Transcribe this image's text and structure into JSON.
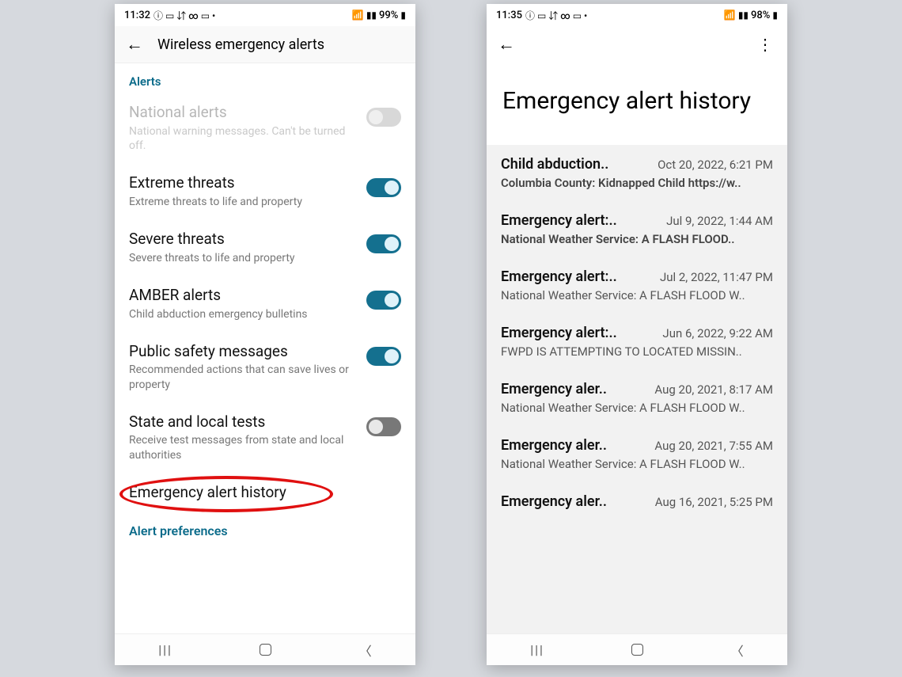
{
  "left": {
    "status": {
      "time": "11:32",
      "battery": "99%"
    },
    "title": "Wireless emergency alerts",
    "section": "Alerts",
    "items": [
      {
        "title": "National alerts",
        "sub": "National warning messages. Can't be turned off.",
        "state": "disabled"
      },
      {
        "title": "Extreme threats",
        "sub": "Extreme threats to life and property",
        "state": "on"
      },
      {
        "title": "Severe threats",
        "sub": "Severe threats to life and property",
        "state": "on"
      },
      {
        "title": "AMBER alerts",
        "sub": "Child abduction emergency bulletins",
        "state": "on"
      },
      {
        "title": "Public safety messages",
        "sub": "Recommended actions that can save lives or property",
        "state": "on"
      },
      {
        "title": "State and local tests",
        "sub": "Receive test messages from state and local authorities",
        "state": "off"
      }
    ],
    "history_link": "Emergency alert history",
    "pref_link": "Alert preferences"
  },
  "right": {
    "status": {
      "time": "11:35",
      "battery": "98%"
    },
    "title": "Emergency alert history",
    "items": [
      {
        "title": "Child abduction..",
        "date": "Oct 20, 2022, 6:21 PM",
        "body": "Columbia County: Kidnapped Child https://w..",
        "bold": true
      },
      {
        "title": "Emergency alert:..",
        "date": "Jul 9, 2022, 1:44 AM",
        "body": "National Weather Service: A FLASH FLOOD..",
        "bold": true
      },
      {
        "title": "Emergency alert:..",
        "date": "Jul 2, 2022, 11:47 PM",
        "body": "National Weather Service: A FLASH FLOOD W..",
        "bold": false
      },
      {
        "title": "Emergency alert:..",
        "date": "Jun 6, 2022, 9:22 AM",
        "body": "FWPD IS ATTEMPTING TO LOCATED MISSIN..",
        "bold": false
      },
      {
        "title": "Emergency aler..",
        "date": "Aug 20, 2021, 8:17 AM",
        "body": "National Weather Service: A FLASH FLOOD W..",
        "bold": false
      },
      {
        "title": "Emergency aler..",
        "date": "Aug 20, 2021, 7:55 AM",
        "body": "National Weather Service: A FLASH FLOOD W..",
        "bold": false
      },
      {
        "title": "Emergency aler..",
        "date": "Aug 16, 2021, 5:25 PM",
        "body": "",
        "bold": false
      }
    ]
  }
}
